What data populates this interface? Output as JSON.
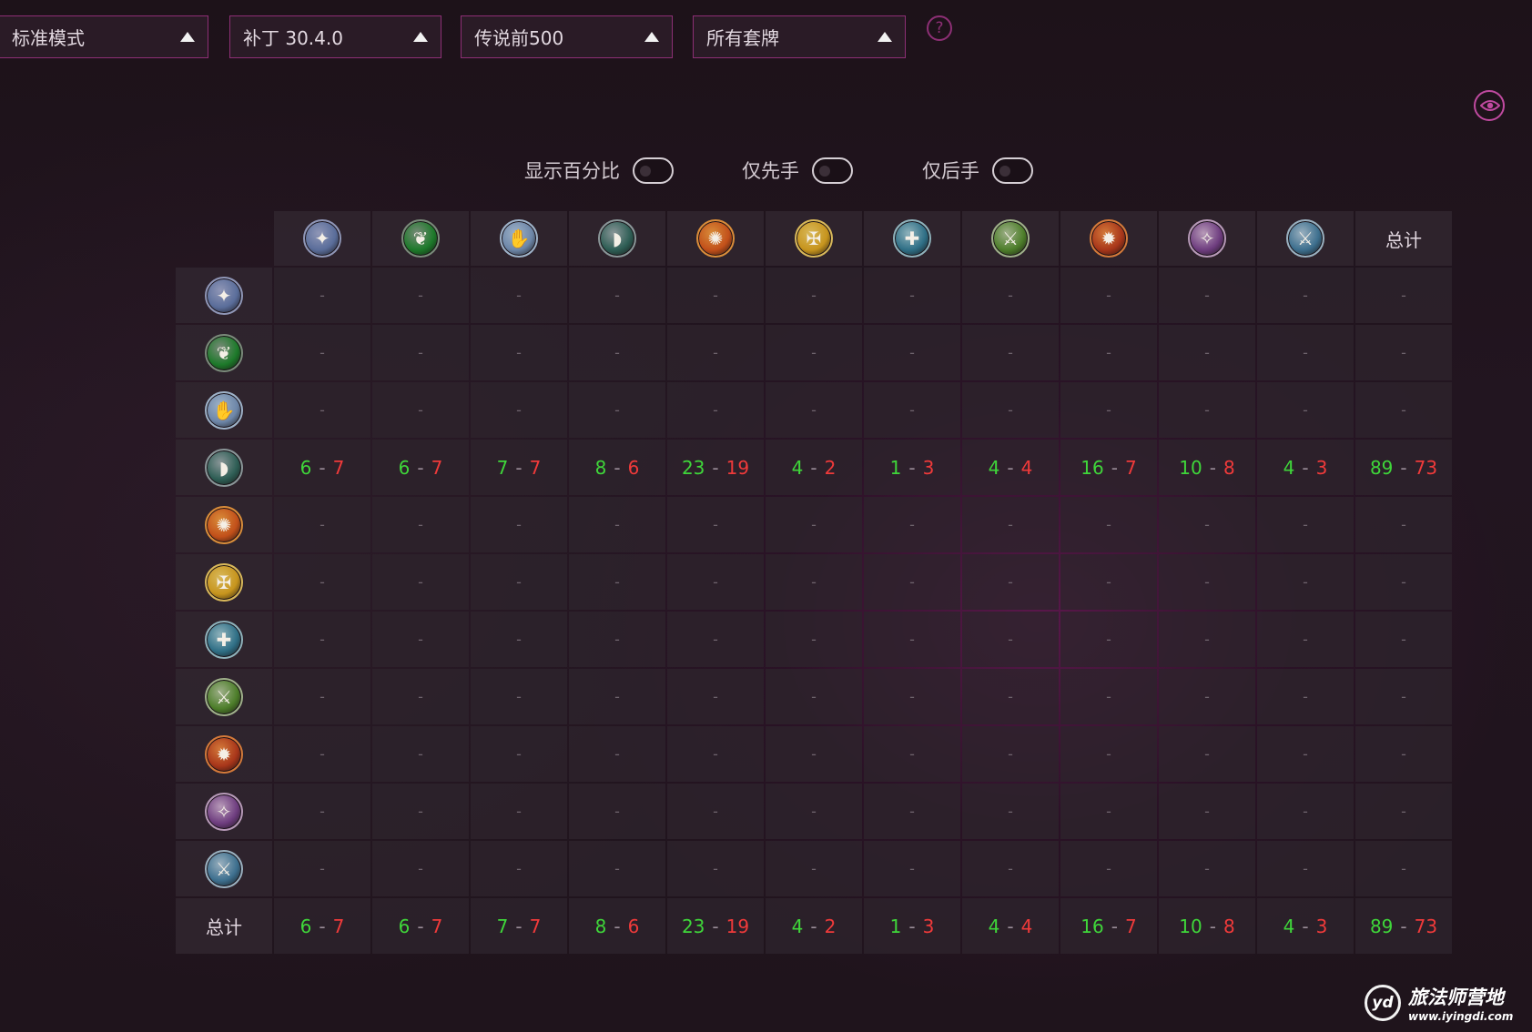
{
  "filters": [
    {
      "label": "标准模式"
    },
    {
      "label": "补丁 30.4.0"
    },
    {
      "label": "传说前500"
    },
    {
      "label": "所有套牌"
    }
  ],
  "help_label": "?",
  "toggles": [
    {
      "label": "显示百分比",
      "on": false
    },
    {
      "label": "仅先手",
      "on": false
    },
    {
      "label": "仅后手",
      "on": false
    }
  ],
  "classes": [
    {
      "name": "death-knight-icon",
      "glyph": "✦",
      "color": "#5a6d9a",
      "ring": "#8f96b6"
    },
    {
      "name": "demon-hunter-icon",
      "glyph": "❦",
      "color": "#1d7a2a",
      "ring": "#7a8a7a"
    },
    {
      "name": "druid-icon",
      "glyph": "✋",
      "color": "#6d86a8",
      "ring": "#9eb2c8"
    },
    {
      "name": "hunter-icon",
      "glyph": "◗",
      "color": "#2e5e55",
      "ring": "#8a9698"
    },
    {
      "name": "mage-icon",
      "glyph": "✺",
      "color": "#c2501a",
      "ring": "#d98d3a"
    },
    {
      "name": "paladin-icon",
      "glyph": "✠",
      "color": "#c7951e",
      "ring": "#d8b85a"
    },
    {
      "name": "priest-icon",
      "glyph": "✚",
      "color": "#2f6f86",
      "ring": "#8fb2bb"
    },
    {
      "name": "rogue-icon",
      "glyph": "⚔",
      "color": "#4d7e2a",
      "ring": "#9fb08a"
    },
    {
      "name": "shaman-icon",
      "glyph": "✹",
      "color": "#a8361a",
      "ring": "#d47a3a"
    },
    {
      "name": "warlock-icon",
      "glyph": "✧",
      "color": "#6e3d7f",
      "ring": "#b79ab8"
    },
    {
      "name": "warrior-icon",
      "glyph": "⚔",
      "color": "#3d6f8e",
      "ring": "#9ab0bf"
    }
  ],
  "total_label": "总计",
  "empty_value": "-",
  "rows": [
    {
      "cells": [
        null,
        null,
        null,
        null,
        null,
        null,
        null,
        null,
        null,
        null,
        null,
        null
      ]
    },
    {
      "cells": [
        null,
        null,
        null,
        null,
        null,
        null,
        null,
        null,
        null,
        null,
        null,
        null
      ]
    },
    {
      "cells": [
        null,
        null,
        null,
        null,
        null,
        null,
        null,
        null,
        null,
        null,
        null,
        null
      ]
    },
    {
      "cells": [
        [
          "6",
          "7"
        ],
        [
          "6",
          "7"
        ],
        [
          "7",
          "7"
        ],
        [
          "8",
          "6"
        ],
        [
          "23",
          "19"
        ],
        [
          "4",
          "2"
        ],
        [
          "1",
          "3"
        ],
        [
          "4",
          "4"
        ],
        [
          "16",
          "7"
        ],
        [
          "10",
          "8"
        ],
        [
          "4",
          "3"
        ],
        [
          "89",
          "73"
        ]
      ]
    },
    {
      "cells": [
        null,
        null,
        null,
        null,
        null,
        null,
        null,
        null,
        null,
        null,
        null,
        null
      ]
    },
    {
      "cells": [
        null,
        null,
        null,
        null,
        null,
        null,
        null,
        null,
        null,
        null,
        null,
        null
      ]
    },
    {
      "cells": [
        null,
        null,
        null,
        null,
        null,
        null,
        null,
        null,
        null,
        null,
        null,
        null
      ]
    },
    {
      "cells": [
        null,
        null,
        null,
        null,
        null,
        null,
        null,
        null,
        null,
        null,
        null,
        null
      ]
    },
    {
      "cells": [
        null,
        null,
        null,
        null,
        null,
        null,
        null,
        null,
        null,
        null,
        null,
        null
      ]
    },
    {
      "cells": [
        null,
        null,
        null,
        null,
        null,
        null,
        null,
        null,
        null,
        null,
        null,
        null
      ]
    },
    {
      "cells": [
        null,
        null,
        null,
        null,
        null,
        null,
        null,
        null,
        null,
        null,
        null,
        null
      ]
    }
  ],
  "totals": [
    [
      "6",
      "7"
    ],
    [
      "6",
      "7"
    ],
    [
      "7",
      "7"
    ],
    [
      "8",
      "6"
    ],
    [
      "23",
      "19"
    ],
    [
      "4",
      "2"
    ],
    [
      "1",
      "3"
    ],
    [
      "4",
      "4"
    ],
    [
      "16",
      "7"
    ],
    [
      "10",
      "8"
    ],
    [
      "4",
      "3"
    ],
    [
      "89",
      "73"
    ]
  ],
  "colors": {
    "win": "#3fd63a",
    "loss": "#f03a3a",
    "accent": "#8d2f75"
  },
  "logo": {
    "mark": "yd",
    "name": "旅法师营地",
    "url": "www.iyingdi.com"
  }
}
